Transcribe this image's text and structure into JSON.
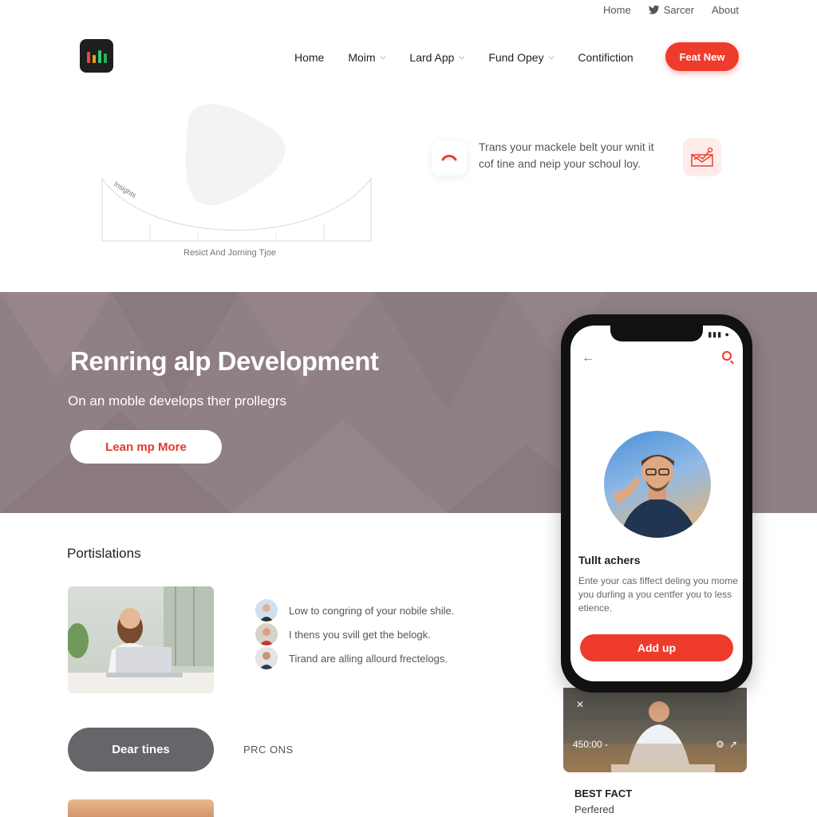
{
  "util_nav": {
    "home": "Home",
    "search": "Sarcer",
    "about": "About"
  },
  "nav": {
    "items": [
      {
        "label": "Home",
        "dropdown": false
      },
      {
        "label": "Moim",
        "dropdown": true
      },
      {
        "label": "Lard App",
        "dropdown": true
      },
      {
        "label": "Fund Opey",
        "dropdown": true
      },
      {
        "label": "Contifiction",
        "dropdown": false
      }
    ],
    "cta": "Feat New"
  },
  "hero": {
    "graphic_label": "Insights",
    "caption": "Resict And Jorning Tjoe"
  },
  "feature": {
    "text": "Trans your mackele belt your wnit it cof tine and neip your schoul loy."
  },
  "banner": {
    "title": "Renring alp Development",
    "subtitle": "On an moble develops ther prollegrs",
    "button": "Lean mp More"
  },
  "phone": {
    "card_title": "Tullt achers",
    "card_text": "Ente your cas fiffect deling you mome you durling a you centfer you to less etience.",
    "button": "Add up"
  },
  "section": {
    "title": "Portislations",
    "list": [
      "Low to congring of your nobile shile.",
      "I thens you svill get the belogk.",
      "Tirand are alling allourd frectelogs."
    ],
    "pill_button": "Dear tines",
    "pill_side": "PRC ONS"
  },
  "card2": {
    "time": "450:00 -"
  },
  "bottom": {
    "title": "BEST FACT",
    "subtitle": "Perfered"
  },
  "colors": {
    "accent": "#ef3b2c",
    "banner": "#8f7f86",
    "dark_pill": "#65656a"
  }
}
